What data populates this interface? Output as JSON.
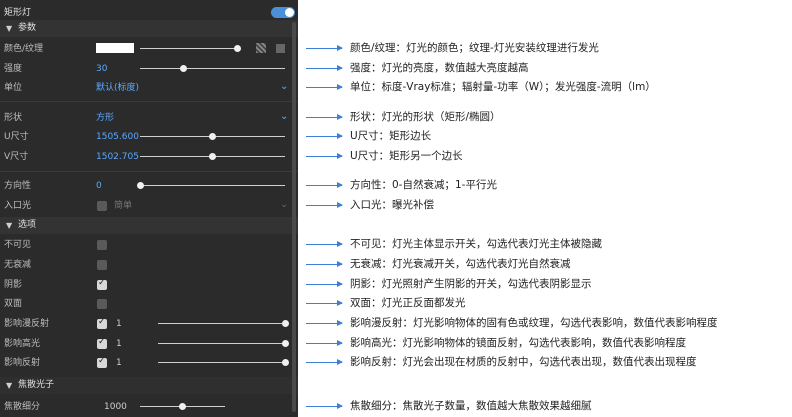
{
  "panel": {
    "title": "矩形灯",
    "sections": {
      "params": "参数",
      "options": "选项",
      "caustics": "焦散光子"
    },
    "rows": {
      "color": {
        "label": "颜色/纹理"
      },
      "intensity": {
        "label": "强度",
        "value": "30"
      },
      "unit": {
        "label": "单位",
        "value": "默认(标度)"
      },
      "shape": {
        "label": "形状",
        "value": "方形"
      },
      "usize": {
        "label": "U尺寸",
        "value": "1505.600"
      },
      "vsize": {
        "label": "V尺寸",
        "value": "1502.705"
      },
      "directivity": {
        "label": "方向性",
        "value": "0"
      },
      "portal": {
        "label": "入口光",
        "value": "简单"
      },
      "invisible": {
        "label": "不可见"
      },
      "nodecay": {
        "label": "无衰减"
      },
      "shadow": {
        "label": "阴影"
      },
      "doublesided": {
        "label": "双面"
      },
      "diffuse": {
        "label": "影响漫反射",
        "value": "1"
      },
      "specular": {
        "label": "影响高光",
        "value": "1"
      },
      "reflection": {
        "label": "影响反射",
        "value": "1"
      },
      "caustic_sub": {
        "label": "焦散细分",
        "value": "1000"
      }
    }
  },
  "annotations": {
    "color": "颜色/纹理：灯光的颜色；纹理-灯光安装纹理进行发光",
    "intensity": "强度：灯光的亮度，数值越大亮度越高",
    "unit": "单位：标度-Vray标准；辐射量-功率（W）；发光强度-流明（lm）",
    "shape": "形状：灯光的形状（矩形/椭圆）",
    "usize": "U尺寸：矩形边长",
    "vsize": "U尺寸：矩形另一个边长",
    "directivity": "方向性：0-自然衰减；1-平行光",
    "portal": "入口光：曝光补偿",
    "invisible": "不可见：灯光主体显示开关，勾选代表灯光主体被隐藏",
    "nodecay": "无衰减：灯光衰减开关，勾选代表灯光自然衰减",
    "shadow": "阴影：灯光照射产生阴影的开关，勾选代表阴影显示",
    "doublesided": "双面：灯光正反面都发光",
    "diffuse": "影响漫反射：灯光影响物体的固有色或纹理，勾选代表影响，数值代表影响程度",
    "specular": "影响高光：灯光影响物体的镜面反射，勾选代表影响，数值代表影响程度",
    "reflection": "影响反射：灯光会出现在材质的反射中，勾选代表出现，数值代表出现程度",
    "caustic_sub": "焦散细分：焦散光子数量，数值越大焦散效果越细腻"
  },
  "colors": {
    "accent": "#5aa9ff",
    "arrow": "#3b7fd6",
    "panel_bg": "#2b2b2b"
  },
  "sliders": {
    "color": 0.97,
    "intensity": 0.3,
    "usize": 0.5,
    "vsize": 0.5,
    "directivity": 0.0,
    "diffuse": 1.0,
    "specular": 1.0,
    "reflection": 1.0,
    "caustic_sub": 0.5
  }
}
